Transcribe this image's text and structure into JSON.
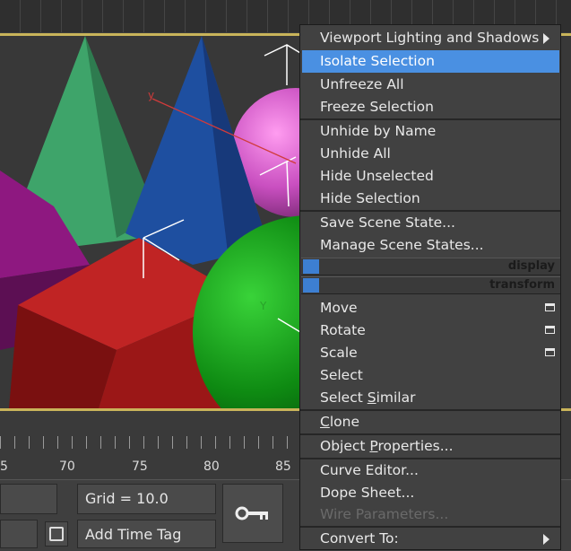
{
  "timeline": {
    "ruler_labels": [
      "5",
      "70",
      "75",
      "80",
      "85"
    ]
  },
  "statusbar": {
    "grid_label": "Grid = 10.0",
    "add_time_tag": "Add Time Tag",
    "key_icon": "key-icon"
  },
  "menu": {
    "items": [
      {
        "label": "Viewport Lighting and Shadows",
        "submenu": true
      },
      {
        "label": "Isolate Selection",
        "selected": true
      },
      {
        "label": "Unfreeze All"
      },
      {
        "label": "Freeze Selection"
      },
      {
        "label": "Unhide by Name"
      },
      {
        "label": "Unhide All"
      },
      {
        "label": "Hide Unselected"
      },
      {
        "label": "Hide Selection"
      },
      {
        "label": "Save Scene State..."
      },
      {
        "label": "Manage Scene States..."
      },
      {
        "label": "Move",
        "has_settings": true
      },
      {
        "label": "Rotate",
        "has_settings": true
      },
      {
        "label": "Scale",
        "has_settings": true
      },
      {
        "label": "Select"
      },
      {
        "label_pre": "Select ",
        "label_u": "S",
        "label_post": "imilar"
      },
      {
        "label_pre": "",
        "label_u": "C",
        "label_post": "lone"
      },
      {
        "label_pre": "Object ",
        "label_u": "P",
        "label_post": "roperties..."
      },
      {
        "label": "Curve Editor..."
      },
      {
        "label": "Dope Sheet..."
      },
      {
        "label": "Wire Parameters...",
        "disabled": true
      },
      {
        "label": "Convert To:",
        "submenu": true
      }
    ],
    "quad_labels": {
      "display": "display",
      "transform": "transform"
    }
  },
  "colors": {
    "selection": "#4a90e2",
    "viewport_border": "#c9b45a",
    "quad_marker": "#3d7fd2"
  }
}
